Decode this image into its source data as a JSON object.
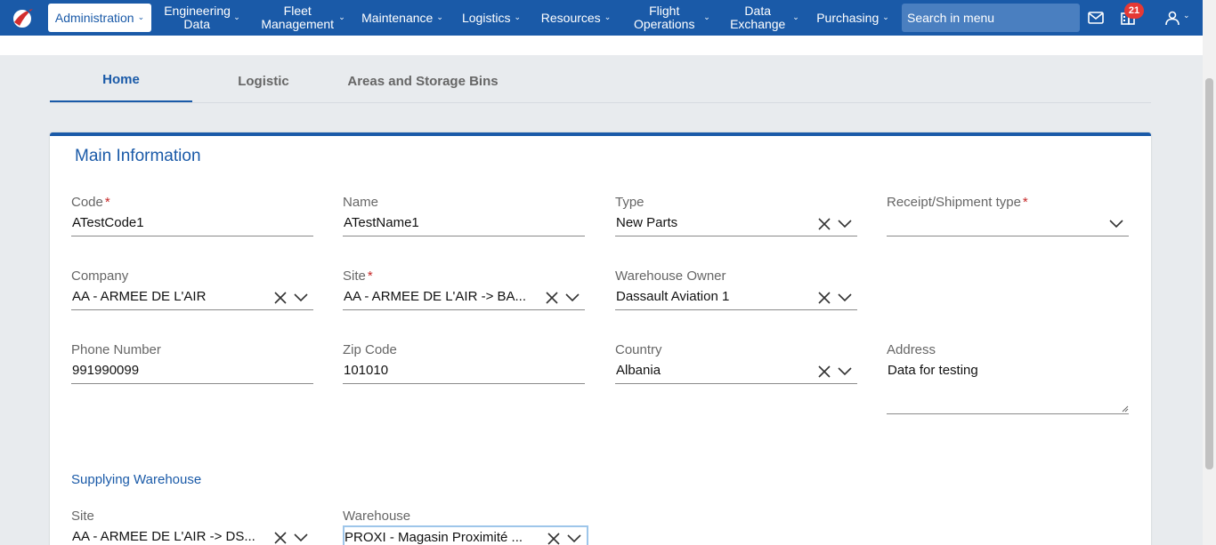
{
  "nav": {
    "items": [
      {
        "label": "Administration"
      },
      {
        "label": "Engineering Data"
      },
      {
        "label": "Fleet Management"
      },
      {
        "label": "Maintenance"
      },
      {
        "label": "Logistics"
      },
      {
        "label": "Resources"
      },
      {
        "label": "Flight Operations"
      },
      {
        "label": "Data Exchange"
      },
      {
        "label": "Purchasing"
      }
    ],
    "search_placeholder": "Search in menu",
    "notification_count": "21",
    "accent": "#1a5aa8"
  },
  "tabs": [
    {
      "label": "Home",
      "active": true
    },
    {
      "label": "Logistic"
    },
    {
      "label": "Areas and Storage Bins"
    }
  ],
  "main": {
    "title": "Main Information",
    "fields": {
      "code": {
        "label": "Code",
        "required": "*",
        "value": "ATestCode1"
      },
      "name": {
        "label": "Name",
        "value": "ATestName1"
      },
      "type": {
        "label": "Type",
        "value": "New Parts"
      },
      "receipt": {
        "label": "Receipt/Shipment type",
        "required": "*",
        "value": ""
      },
      "company": {
        "label": "Company",
        "value": "AA - ARMEE DE L'AIR"
      },
      "site": {
        "label": "Site",
        "required": "*",
        "value": "AA - ARMEE DE L'AIR -> BA..."
      },
      "owner": {
        "label": "Warehouse Owner",
        "value": "Dassault Aviation 1"
      },
      "phone": {
        "label": "Phone Number",
        "value": "991990099"
      },
      "zip": {
        "label": "Zip Code",
        "value": "101010"
      },
      "country": {
        "label": "Country",
        "value": "Albania"
      },
      "address": {
        "label": "Address",
        "value": "Data for testing"
      }
    }
  },
  "supplying": {
    "title": "Supplying Warehouse",
    "site": {
      "label": "Site",
      "value": "AA - ARMEE DE L'AIR -> DS..."
    },
    "warehouse": {
      "label": "Warehouse",
      "value": "PROXI - Magasin Proximité ..."
    }
  }
}
